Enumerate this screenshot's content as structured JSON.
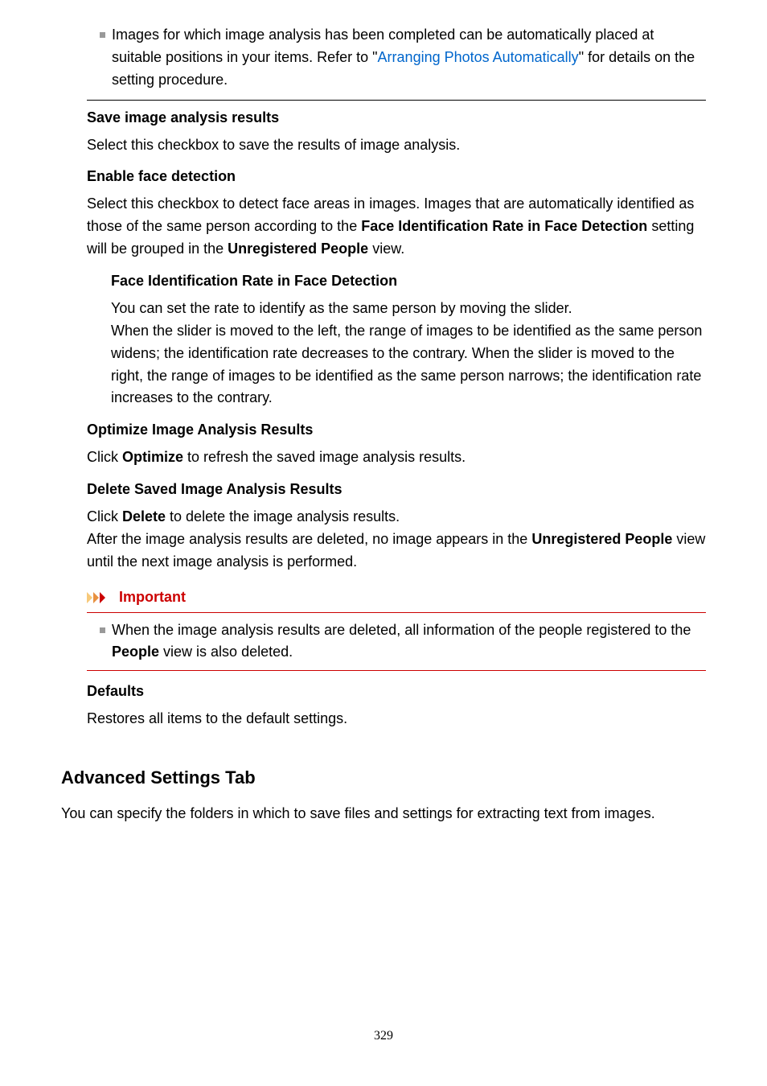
{
  "topnote": {
    "pre": "Images for which image analysis has been completed can be automatically placed at suitable positions in your items. Refer to \"",
    "link": "Arranging Photos Automatically",
    "post": "\" for details on the setting procedure."
  },
  "sections": {
    "saveResults": {
      "heading": "Save image analysis results",
      "body": "Select this checkbox to save the results of image analysis."
    },
    "enableFace": {
      "heading": "Enable face detection",
      "body_pre": "Select this checkbox to detect face areas in images. Images that are automatically identified as those of the same person according to the ",
      "b1": "Face Identification Rate in Face Detection",
      "mid": " setting will be grouped in the ",
      "b2": "Unregistered People",
      "post": " view.",
      "sub": {
        "heading": "Face Identification Rate in Face Detection",
        "p1": "You can set the rate to identify as the same person by moving the slider.",
        "p2": "When the slider is moved to the left, the range of images to be identified as the same person widens; the identification rate decreases to the contrary. When the slider is moved to the right, the range of images to be identified as the same person narrows; the identification rate increases to the contrary."
      }
    },
    "optimize": {
      "heading": "Optimize Image Analysis Results",
      "body_pre": "Click ",
      "b1": "Optimize",
      "body_post": " to refresh the saved image analysis results."
    },
    "deleteResults": {
      "heading": "Delete Saved Image Analysis Results",
      "p1_pre": "Click ",
      "p1_b": "Delete",
      "p1_post": " to delete the image analysis results.",
      "p2_pre": "After the image analysis results are deleted, no image appears in the ",
      "p2_b": "Unregistered People",
      "p2_post": " view until the next image analysis is performed."
    },
    "important": {
      "label": "Important",
      "body_pre": "When the image analysis results are deleted, all information of the people registered to the ",
      "b1": "People",
      "body_post": " view is also deleted."
    },
    "defaults": {
      "heading": "Defaults",
      "body": "Restores all items to the default settings."
    },
    "advanced": {
      "heading": "Advanced Settings Tab",
      "body": "You can specify the folders in which to save files and settings for extracting text from images."
    }
  },
  "icons": {
    "chevrons": "chevrons-right-icon"
  },
  "pageNumber": "329"
}
